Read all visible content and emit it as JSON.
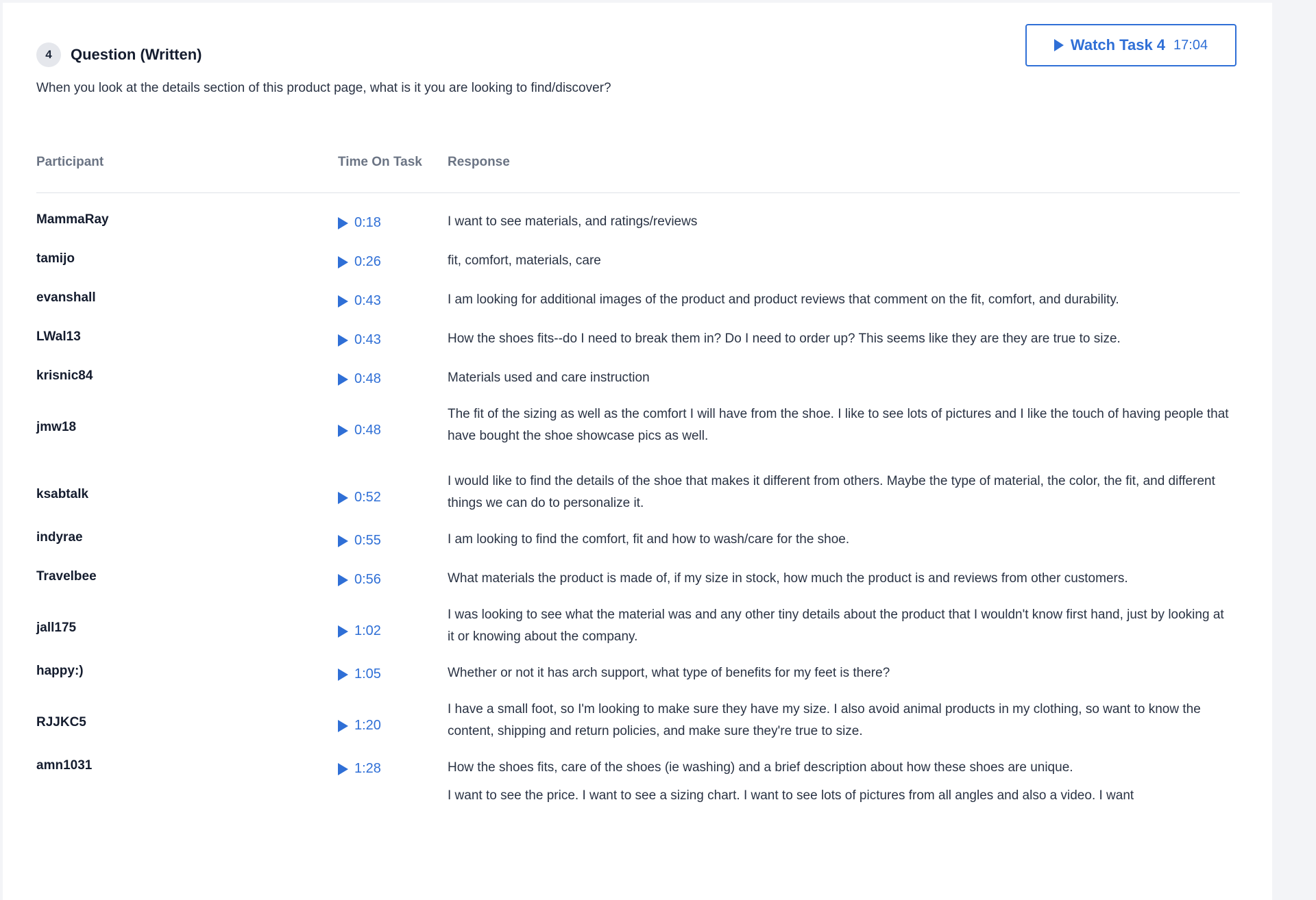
{
  "task": {
    "number": "4",
    "title": "Question (Written)",
    "question": "When you look at the details section of this product page, what is it you are looking to find/discover?"
  },
  "watch_button": {
    "label": "Watch Task 4",
    "duration": "17:04"
  },
  "table": {
    "headers": {
      "participant": "Participant",
      "time_on_task": "Time On Task",
      "response": "Response"
    },
    "rows": [
      {
        "participant": "MammaRay",
        "time": "0:18",
        "response": "I want to see materials, and ratings/reviews"
      },
      {
        "participant": "tamijo",
        "time": "0:26",
        "response": "fit, comfort, materials, care"
      },
      {
        "participant": "evanshall",
        "time": "0:43",
        "response": "I am looking for additional images of the product and product reviews that comment on the fit, comfort, and durability."
      },
      {
        "participant": "LWal13",
        "time": "0:43",
        "response": "How the shoes fits--do I need to break them in? Do I need to order up? This seems like they are they are true to size."
      },
      {
        "participant": "krisnic84",
        "time": "0:48",
        "response": "Materials used and care instruction"
      },
      {
        "participant": "jmw18",
        "time": "0:48",
        "response": "The fit of the sizing as well as the comfort I will have from the shoe. I like to see lots of pictures and I like the touch of having people that have bought the shoe showcase pics as well."
      },
      {
        "participant": "ksabtalk",
        "time": "0:52",
        "response": "I would like to find the details of the shoe that makes it different from others. Maybe the type of material, the color, the fit, and different things we can do to personalize it."
      },
      {
        "participant": "indyrae",
        "time": "0:55",
        "response": "I am looking to find the comfort, fit and how to wash/care for the shoe."
      },
      {
        "participant": "Travelbee",
        "time": "0:56",
        "response": "What materials the product is made of, if my size in stock, how much the product is and reviews from other customers."
      },
      {
        "participant": "jall175",
        "time": "1:02",
        "response": "I was looking to see what the material was and any other tiny details about the product that I wouldn't know first hand, just by looking at it or knowing about the company."
      },
      {
        "participant": "happy:)",
        "time": "1:05",
        "response": "Whether or not it has arch support, what type of benefits for my feet is there?"
      },
      {
        "participant": "RJJKC5",
        "time": "1:20",
        "response": "I have a small foot, so I'm looking to make sure they have my size. I also avoid animal products in my clothing, so want to know the content, shipping and return policies, and make sure they're true to size."
      },
      {
        "participant": "amn1031",
        "time": "1:28",
        "response": "How the shoes fits, care of the shoes (ie washing) and a brief description about how these shoes are unique."
      },
      {
        "participant": "",
        "time": "",
        "response": "I want to see the price. I want to see a sizing chart. I want to see lots of pictures from all angles and also a video. I want"
      }
    ]
  },
  "icons": {
    "play": "play-icon"
  },
  "colors": {
    "accent": "#2f6fd6",
    "text": "#2a3344",
    "header_text": "#6b7484"
  }
}
